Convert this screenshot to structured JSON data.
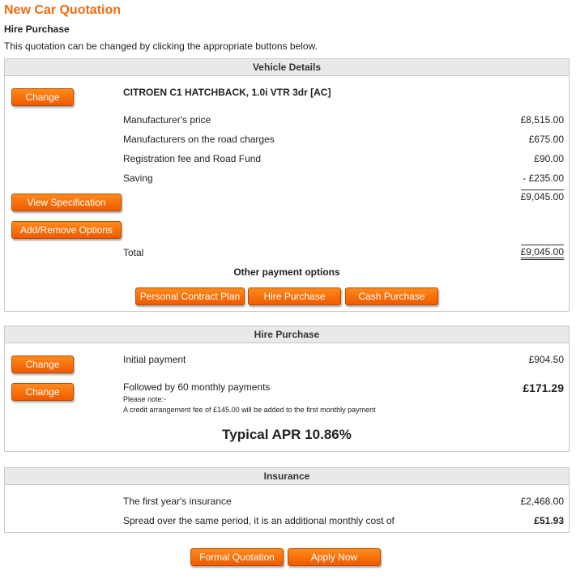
{
  "page": {
    "title": "New Car Quotation",
    "subtitle": "Hire Purchase",
    "intro": "This quotation can be changed by clicking the appropriate buttons below."
  },
  "vehicle": {
    "header": "Vehicle Details",
    "change_label": "Change",
    "view_spec_label": "View Specification",
    "options_label": "Add/Remove Options",
    "name": "CITROEN C1 HATCHBACK, 1.0i VTR 3dr [AC]",
    "rows": [
      {
        "label": "Manufacturer's price",
        "value": "£8,515.00"
      },
      {
        "label": "Manufacturers on the road charges",
        "value": "£675.00"
      },
      {
        "label": "Registration fee and Road Fund",
        "value": "£90.00"
      },
      {
        "label": "Saving",
        "value": "- £235.00"
      }
    ],
    "subtotal": "£9,045.00",
    "total_label": "Total",
    "total_value": "£9,045.00",
    "other_options_label": "Other payment options",
    "pcp_label": "Personal Contract Plan",
    "hp_label": "Hire Purchase",
    "cash_label": "Cash Purchase"
  },
  "hire_purchase": {
    "header": "Hire Purchase",
    "change_label": "Change",
    "initial_label": "Initial payment",
    "initial_value": "£904.50",
    "monthly_label": "Followed by 60 monthly payments",
    "monthly_value": "£171.29",
    "note_heading": "Please note:-",
    "note_text": "A credit arrangement fee of £145.00 will be added to the first monthly payment",
    "apr": "Typical APR 10.86%"
  },
  "insurance": {
    "header": "Insurance",
    "first_year_label": "The first year's insurance",
    "first_year_value": "£2,468.00",
    "spread_label": "Spread over the same period, it is an additional monthly cost of",
    "spread_value": "£51.93"
  },
  "footer": {
    "formal_label": "Formal Quotation",
    "apply_label": "Apply Now"
  },
  "colors": {
    "accent": "#f26b0f",
    "button": "#f56a00",
    "panel_header": "#e9e9e9"
  }
}
